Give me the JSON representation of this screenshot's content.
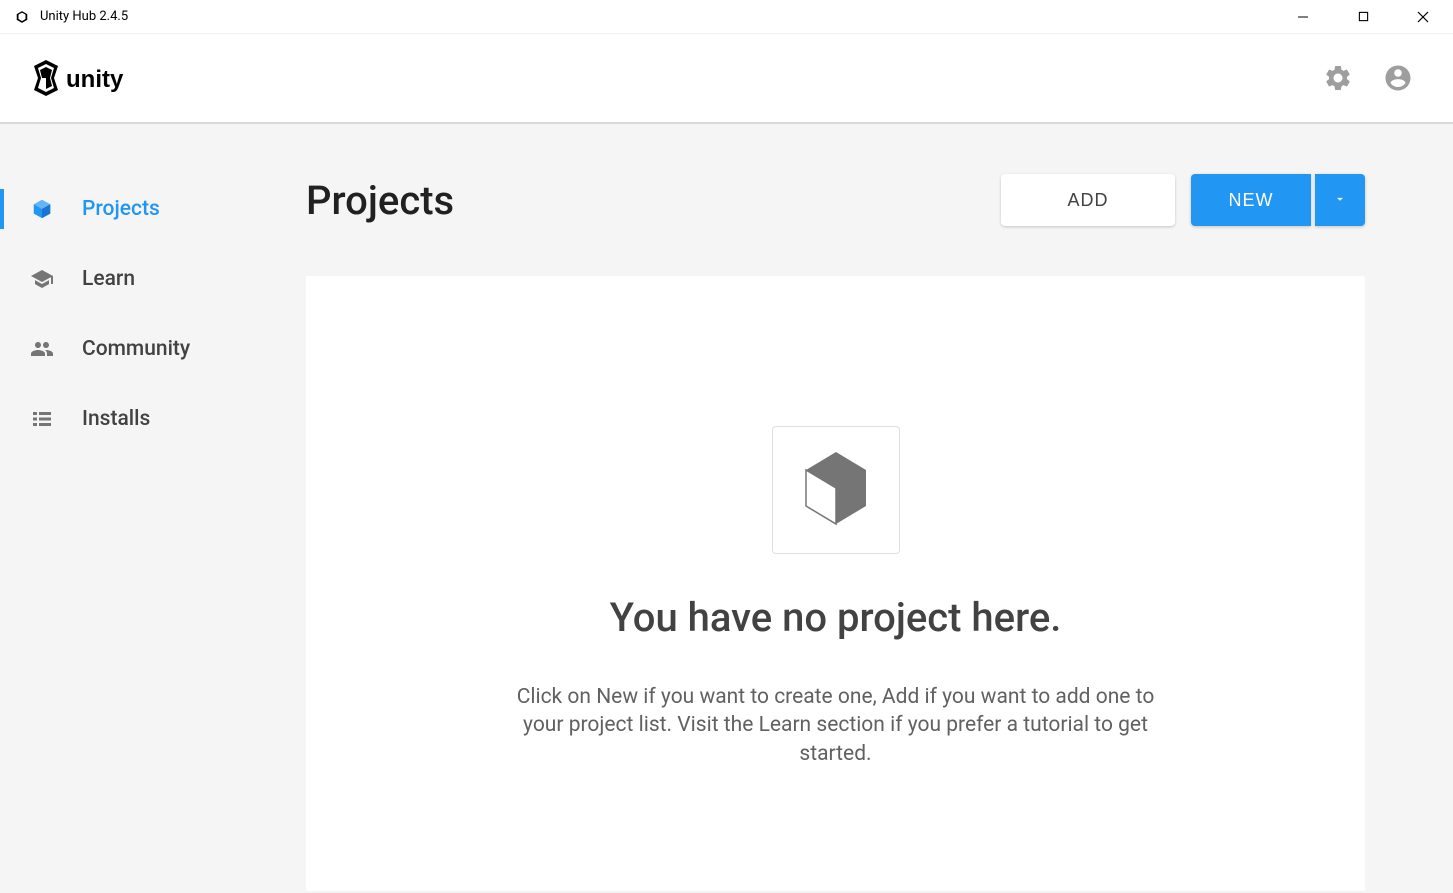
{
  "titlebar": {
    "title": "Unity Hub 2.4.5"
  },
  "header": {
    "brand": "unity"
  },
  "sidebar": {
    "items": [
      {
        "label": "Projects",
        "active": true
      },
      {
        "label": "Learn",
        "active": false
      },
      {
        "label": "Community",
        "active": false
      },
      {
        "label": "Installs",
        "active": false
      }
    ]
  },
  "main": {
    "title": "Projects",
    "add_label": "ADD",
    "new_label": "NEW",
    "empty": {
      "headline": "You have no project here.",
      "description": "Click on New if you want to create one, Add if you want to add one to your project list. Visit the Learn section if you prefer a tutorial to get started."
    }
  }
}
